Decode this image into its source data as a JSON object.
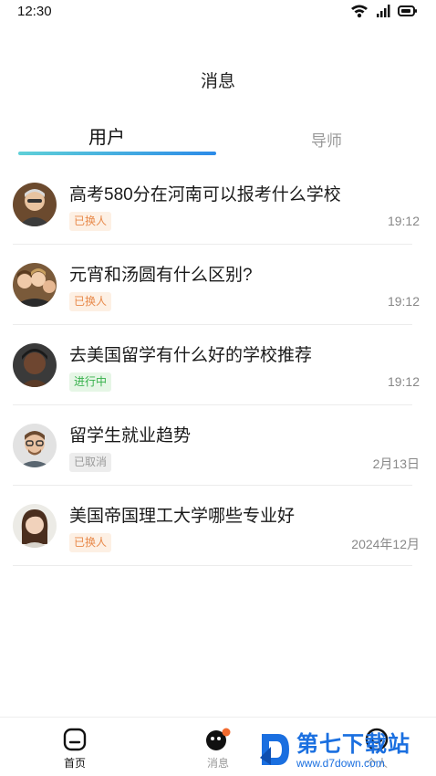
{
  "status_bar": {
    "time": "12:30"
  },
  "header": {
    "title": "消息"
  },
  "tabs": [
    {
      "label": "用户",
      "active": true
    },
    {
      "label": "导师",
      "active": false
    }
  ],
  "messages": [
    {
      "title": "高考580分在河南可以报考什么学校",
      "status": "已换人",
      "status_color": "orange",
      "time": "19:12"
    },
    {
      "title": "元宵和汤圆有什么区别?",
      "status": "已换人",
      "status_color": "orange",
      "time": "19:12"
    },
    {
      "title": "去美国留学有什么好的学校推荐",
      "status": "进行中",
      "status_color": "green",
      "time": "19:12"
    },
    {
      "title": "留学生就业趋势",
      "status": "已取消",
      "status_color": "gray",
      "time": "2月13日"
    },
    {
      "title": "美国帝国理工大学哪些专业好",
      "status": "已换人",
      "status_color": "orange",
      "time": "2024年12月"
    }
  ],
  "bottom_nav": [
    {
      "label": "首页",
      "icon": "home-icon",
      "active": true
    },
    {
      "label": "消息",
      "icon": "message-icon",
      "active": false
    },
    {
      "label": "个人",
      "icon": "profile-icon",
      "active": false
    }
  ],
  "watermark": {
    "main": "第七下载站",
    "sub": "www.d7down.com"
  },
  "colors": {
    "accent_start": "#5fd0d8",
    "accent_end": "#2c8be8",
    "badge_orange": "#e8894a",
    "badge_green": "#35b04a",
    "badge_gray": "#9a9a9a",
    "notification_dot": "#f26a2e"
  }
}
